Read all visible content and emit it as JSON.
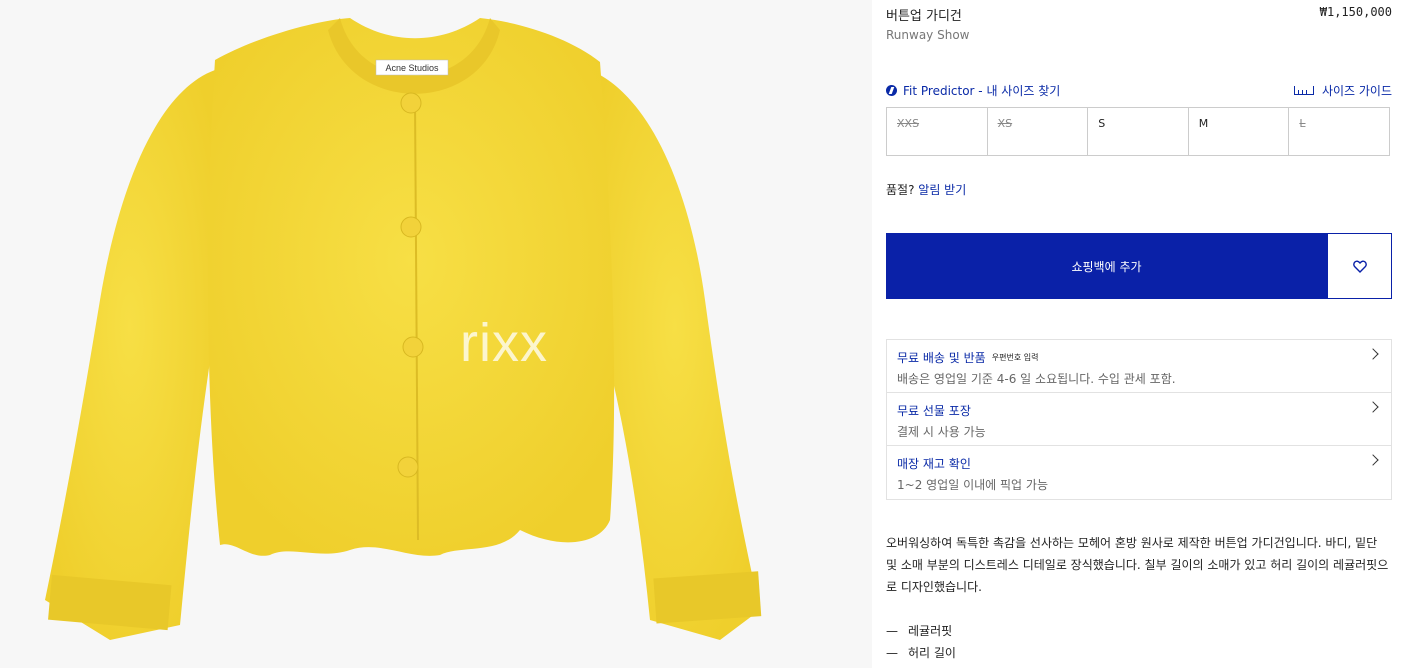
{
  "product": {
    "title": "버튼업 가디건",
    "price": "₩1,150,000",
    "subtitle": "Runway Show",
    "image_label": "Acne Studios",
    "watermark": "rixx"
  },
  "fit": {
    "predictor_label": "Fit Predictor - 내 사이즈 찾기",
    "size_guide_label": "사이즈 가이드"
  },
  "sizes": [
    {
      "label": "XXS",
      "available": false
    },
    {
      "label": "XS",
      "available": false
    },
    {
      "label": "S",
      "available": true
    },
    {
      "label": "M",
      "available": true
    },
    {
      "label": "L",
      "available": false
    }
  ],
  "soldout": {
    "prefix": "품절?",
    "link": "알림 받기"
  },
  "cart": {
    "add_label": "쇼핑백에 추가"
  },
  "services": [
    {
      "title": "무료 배송 및 반품",
      "note": "우편번호 입력",
      "desc": "배송은 영업일 기준 4-6 일 소요됩니다. 수입 관세 포함."
    },
    {
      "title": "무료 선물 포장",
      "note": "",
      "desc": "결제 시 사용 가능"
    },
    {
      "title": "매장 재고 확인",
      "note": "",
      "desc": "1~2 영업일 이내에 픽업 가능"
    }
  ],
  "description": "오버워싱하여 독특한 촉감을 선사하는 모헤어 혼방 원사로 제작한 버튼업 가디건입니다. 바디, 밑단 및 소매 부분의 디스트레스 디테일로 장식했습니다. 칠부 길이의 소매가 있고 허리 길이의 레귤러핏으로 디자인했습니다.",
  "bullets": [
    "레귤러핏",
    "허리 길이"
  ],
  "colors": {
    "accent": "#0a2aa7",
    "button": "#0a21a8",
    "sweater": "#f5d93a"
  }
}
